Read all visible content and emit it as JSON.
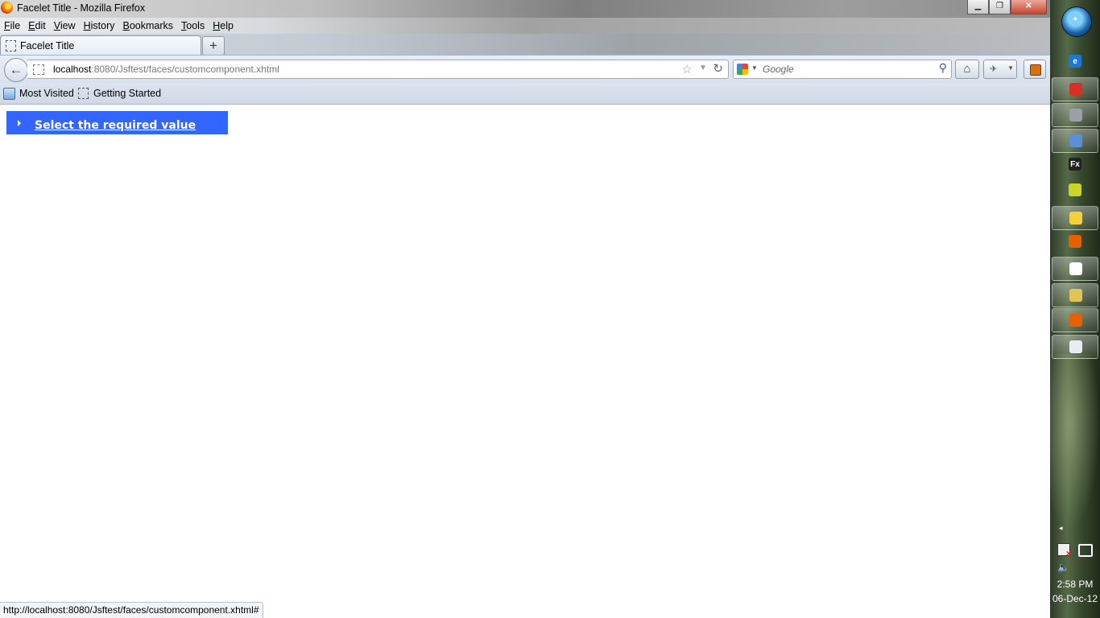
{
  "window": {
    "title": "Facelet Title - Mozilla Firefox",
    "controls": {
      "minimize": "▁",
      "maximize": "❐",
      "close": "✕"
    }
  },
  "menu": [
    "File",
    "Edit",
    "View",
    "History",
    "Bookmarks",
    "Tools",
    "Help"
  ],
  "tabs": [
    {
      "label": "Facelet Title",
      "active": true
    }
  ],
  "new_tab_label": "+",
  "navigation": {
    "back_icon": "←",
    "url_host": "localhost",
    "url_rest": ":8080/Jsftest/faces/customcomponent.xhtml",
    "star_icon": "☆",
    "dropdown_icon": "▼",
    "reload_icon": "↻"
  },
  "search": {
    "placeholder": "Google",
    "go_icon": "⚲",
    "engine_dropdown_icon": "▼"
  },
  "toolbar": {
    "home_icon": "⌂",
    "addon_icon": "✈",
    "addon_dropdown_icon": "▼"
  },
  "bookmarks": [
    {
      "label": "Most Visited"
    },
    {
      "label": "Getting Started"
    }
  ],
  "content": {
    "panel_link": "Select the required value",
    "panel_color": "#3366ff"
  },
  "status_bar": {
    "text": "http://localhost:8080/Jsftest/faces/customcomponent.xhtml#"
  },
  "taskbar": {
    "items": [
      {
        "name": "internet-explorer-icon",
        "glyph": "e",
        "color": "#1b78d6",
        "active": false
      },
      {
        "name": "chrome-icon",
        "glyph": "",
        "color": "#d93025",
        "active": true
      },
      {
        "name": "network-app-icon",
        "glyph": "",
        "color": "#9aa0a6",
        "active": true
      },
      {
        "name": "virtualbox-icon",
        "glyph": "",
        "color": "#5b8fd6",
        "active": true
      },
      {
        "name": "flex-icon",
        "glyph": "Fx",
        "color": "#222222",
        "active": false
      },
      {
        "name": "bug-icon",
        "glyph": "",
        "color": "#c9d32b",
        "active": false
      },
      {
        "name": "chat-icon",
        "glyph": "",
        "color": "#f3d13b",
        "active": true
      },
      {
        "name": "firefox-icon",
        "glyph": "",
        "color": "#e66000",
        "active": false
      },
      {
        "name": "speech-icon",
        "glyph": "",
        "color": "#ffffff",
        "active": true
      },
      {
        "name": "explorer-folder-icon",
        "glyph": "",
        "color": "#e2c35a",
        "active": true
      },
      {
        "name": "firefox-active-icon",
        "glyph": "",
        "color": "#e66000",
        "active": true
      },
      {
        "name": "java-icon",
        "glyph": "",
        "color": "#e8edf3",
        "active": true
      }
    ],
    "tray_expand_icon": "◂",
    "volume_icon": "🔈",
    "clock": {
      "time": "2:58 PM",
      "date": "06-Dec-12"
    }
  }
}
